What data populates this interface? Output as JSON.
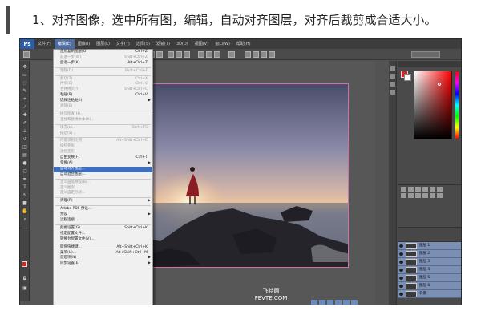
{
  "caption": {
    "text": "1、对齐图像，选中所有图，编辑，自动对齐图层，对齐后裁剪成合适大小。"
  },
  "app": {
    "logo": "Ps"
  },
  "menubar": [
    "文件(F)",
    "编辑(E)",
    "图像(I)",
    "图层(L)",
    "文字(Y)",
    "选择(S)",
    "滤镜(T)",
    "3D(D)",
    "视图(V)",
    "窗口(W)",
    "帮助(H)"
  ],
  "menubar_active_index": 1,
  "edit_menu": [
    {
      "label": "还原复制图层(O)",
      "shortcut": "Ctrl+Z",
      "disabled": false
    },
    {
      "label": "前进一步(W)",
      "shortcut": "Shift+Ctrl+Z",
      "disabled": true
    },
    {
      "label": "后退一步(K)",
      "shortcut": "Alt+Ctrl+Z",
      "disabled": false
    },
    {
      "sep": true
    },
    {
      "label": "渐隐(D)...",
      "shortcut": "Shift+Ctrl+F",
      "disabled": true
    },
    {
      "sep": true
    },
    {
      "label": "剪切(T)",
      "shortcut": "Ctrl+X",
      "disabled": true
    },
    {
      "label": "拷贝(C)",
      "shortcut": "Ctrl+C",
      "disabled": true
    },
    {
      "label": "合并拷贝(Y)",
      "shortcut": "Shift+Ctrl+C",
      "disabled": true
    },
    {
      "label": "粘贴(P)",
      "shortcut": "Ctrl+V",
      "disabled": false
    },
    {
      "label": "选择性粘贴(I)",
      "shortcut": "",
      "disabled": false,
      "submenu": true
    },
    {
      "label": "清除(E)",
      "shortcut": "",
      "disabled": true
    },
    {
      "sep": true
    },
    {
      "label": "拼写检查(H)...",
      "shortcut": "",
      "disabled": true
    },
    {
      "label": "查找和替换文本(X)...",
      "shortcut": "",
      "disabled": true
    },
    {
      "sep": true
    },
    {
      "label": "填充(L)...",
      "shortcut": "Shift+F5",
      "disabled": true
    },
    {
      "label": "描边(S)...",
      "shortcut": "",
      "disabled": true
    },
    {
      "sep": true
    },
    {
      "label": "内容识别比例",
      "shortcut": "Alt+Shift+Ctrl+C",
      "disabled": true
    },
    {
      "label": "操控变形",
      "shortcut": "",
      "disabled": true
    },
    {
      "label": "透视变形",
      "shortcut": "",
      "disabled": true
    },
    {
      "label": "自由变换(F)",
      "shortcut": "Ctrl+T",
      "disabled": false
    },
    {
      "label": "变换(A)",
      "shortcut": "",
      "disabled": false,
      "submenu": true
    },
    {
      "label": "自动对齐图层...",
      "shortcut": "",
      "disabled": false,
      "highlighted": true
    },
    {
      "label": "自动混合图层...",
      "shortcut": "",
      "disabled": false
    },
    {
      "sep": true
    },
    {
      "label": "定义画笔预设(B)...",
      "shortcut": "",
      "disabled": true
    },
    {
      "label": "定义图案...",
      "shortcut": "",
      "disabled": true
    },
    {
      "label": "定义自定形状...",
      "shortcut": "",
      "disabled": true
    },
    {
      "sep": true
    },
    {
      "label": "清理(R)",
      "shortcut": "",
      "disabled": false,
      "submenu": true
    },
    {
      "sep": true
    },
    {
      "label": "Adobe PDF 预设...",
      "shortcut": "",
      "disabled": false
    },
    {
      "label": "预设",
      "shortcut": "",
      "disabled": false,
      "submenu": true
    },
    {
      "label": "远程连接...",
      "shortcut": "",
      "disabled": false
    },
    {
      "sep": true
    },
    {
      "label": "颜色设置(G)...",
      "shortcut": "Shift+Ctrl+K",
      "disabled": false
    },
    {
      "label": "指定配置文件...",
      "shortcut": "",
      "disabled": false
    },
    {
      "label": "转换为配置文件(V)...",
      "shortcut": "",
      "disabled": false
    },
    {
      "sep": true
    },
    {
      "label": "键盘快捷键...",
      "shortcut": "Alt+Shift+Ctrl+K",
      "disabled": false
    },
    {
      "label": "菜单(U)...",
      "shortcut": "Alt+Shift+Ctrl+M",
      "disabled": false
    },
    {
      "label": "首选项(N)",
      "shortcut": "",
      "disabled": false,
      "submenu": true
    },
    {
      "label": "同步设置(E)",
      "shortcut": "",
      "disabled": false,
      "submenu": true
    }
  ],
  "watermark": {
    "line1": "飞特网",
    "line2": "FEVTE.COM"
  },
  "layers": [
    "图层 1",
    "图层 2",
    "图层 3",
    "图层 4",
    "图层 5",
    "图层 6",
    "背景"
  ],
  "colors": {
    "accent": "#3d6fbe",
    "foreground": "#d42525",
    "ps_blue": "#2b5ea8"
  }
}
